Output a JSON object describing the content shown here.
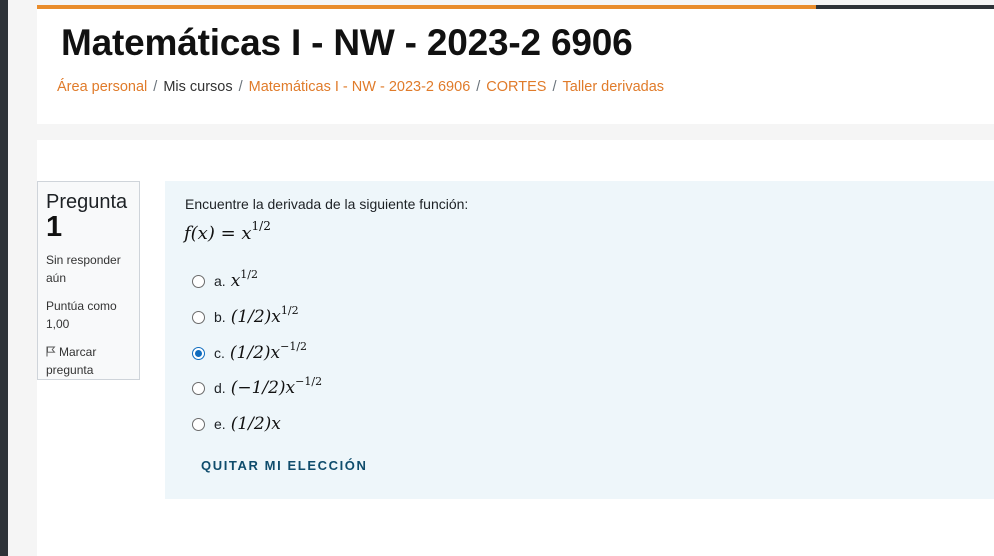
{
  "course": {
    "title": "Matemáticas I - NW - 2023-2 6906",
    "progress_fraction": 0.814
  },
  "breadcrumb": [
    {
      "label": "Área personal",
      "link": true
    },
    {
      "label": "Mis cursos",
      "link": false
    },
    {
      "label": "Matemáticas I - NW - 2023-2 6906",
      "link": true
    },
    {
      "label": "CORTES",
      "link": true
    },
    {
      "label": "Taller derivadas",
      "link": true
    }
  ],
  "breadcrumb_separator": "/",
  "question_info": {
    "label": "Pregunta",
    "number": "1",
    "status": "Sin responder aún",
    "grade": "Puntúa como 1,00",
    "flag_label": "Marcar pregunta",
    "flag_icon": "flag-icon"
  },
  "question": {
    "prompt": "Encuentre la derivada de la siguiente función:",
    "formula": {
      "lhs": "f(x) = x",
      "exp": "1/2"
    },
    "options": [
      {
        "letter": "a.",
        "base": "x",
        "exp": "1/2",
        "checked": false
      },
      {
        "letter": "b.",
        "base": "(1/2)x",
        "exp": "1/2",
        "checked": false
      },
      {
        "letter": "c.",
        "base": "(1/2)x",
        "exp": "−1/2",
        "checked": true
      },
      {
        "letter": "d.",
        "base": "(−1/2)x",
        "exp": "−1/2",
        "checked": false
      },
      {
        "letter": "e.",
        "base": "(1/2)x",
        "exp": "",
        "checked": false
      }
    ],
    "clear_label": "QUITAR MI ELECCIÓN"
  },
  "colors": {
    "accent_orange": "#e07b2a",
    "progress_orange": "#e98c2b",
    "radio_blue": "#0f6cbf",
    "button_text": "#0f4c6c",
    "question_bg": "#eef6fa"
  }
}
